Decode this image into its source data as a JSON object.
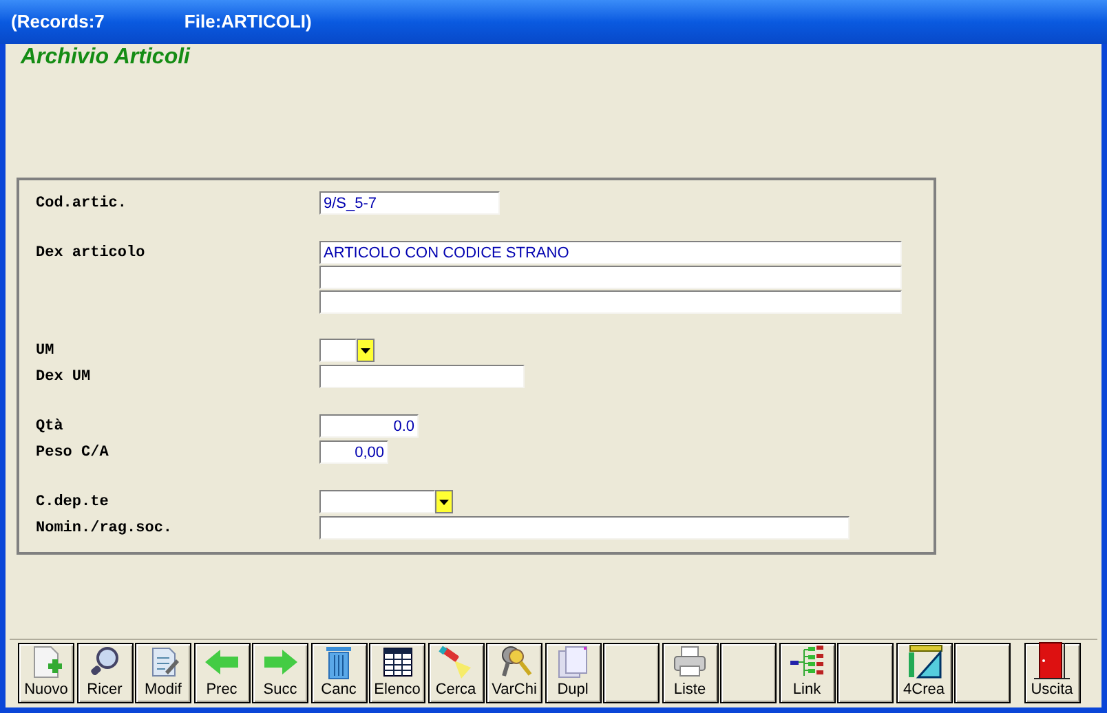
{
  "window": {
    "records": "(Records:7",
    "file": "File:ARTICOLI)"
  },
  "heading": "Archivio Articoli",
  "groups": [
    {
      "fields": [
        {
          "label": "Cod.artic.",
          "value": "9/S_5-7",
          "kind": "text"
        }
      ]
    },
    {
      "fields": [
        {
          "label": "Dex articolo",
          "value": "ARTICOLO CON CODICE STRANO",
          "kind": "multiline"
        }
      ]
    },
    {
      "fields": [
        {
          "label": "UM",
          "kind": "combo"
        },
        {
          "label": "Dex UM",
          "kind": "text"
        }
      ]
    },
    {
      "fields": [
        {
          "label": "Qtà",
          "value": "0.0",
          "kind": "number"
        },
        {
          "label": "Peso C/A",
          "value": "0,00",
          "kind": "number"
        }
      ]
    },
    {
      "fields": [
        {
          "label": "C.dep.te",
          "kind": "combo"
        },
        {
          "label": "Nomin./rag.soc.",
          "kind": "text"
        }
      ]
    }
  ],
  "toolbar": [
    {
      "kind": "button",
      "label": "Nuovo"
    },
    {
      "kind": "button",
      "label": "Ricer"
    },
    {
      "kind": "button",
      "label": "Modif"
    },
    {
      "kind": "button",
      "label": "Prec"
    },
    {
      "kind": "button",
      "label": "Succ"
    },
    {
      "kind": "button",
      "label": "Canc"
    },
    {
      "kind": "button",
      "label": "Elenco"
    },
    {
      "kind": "button",
      "label": "Cerca"
    },
    {
      "kind": "button",
      "label": "VarChi"
    },
    {
      "kind": "button",
      "label": "Dupl"
    },
    {
      "kind": "empty"
    },
    {
      "kind": "button",
      "label": "Liste"
    },
    {
      "kind": "empty"
    },
    {
      "kind": "button",
      "label": "Link"
    },
    {
      "kind": "empty"
    },
    {
      "kind": "button",
      "label": "4Crea"
    },
    {
      "kind": "empty"
    },
    {
      "kind": "exit",
      "label": "Uscita"
    }
  ]
}
